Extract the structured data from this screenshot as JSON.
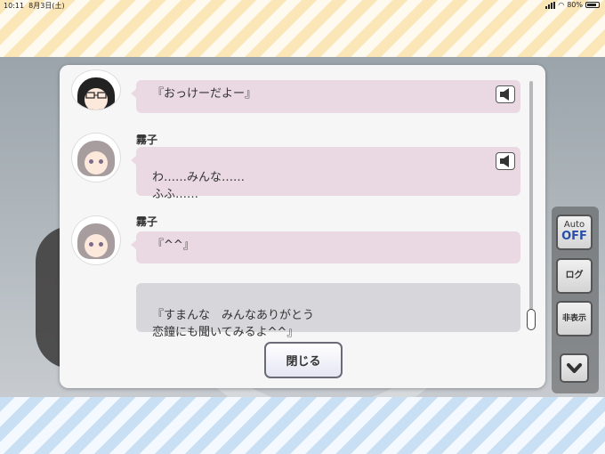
{
  "status_bar": {
    "time": "10:11",
    "date": "8月3日(土)",
    "battery": "80%"
  },
  "log": {
    "entries": [
      {
        "speaker": "",
        "text": "『おっけーだよー』",
        "has_voice": true,
        "avatar": "glasses-character-avatar"
      },
      {
        "speaker": "霧子",
        "text": "わ……みんな……\nふふ……",
        "has_voice": true,
        "avatar": "kiriko-avatar"
      },
      {
        "speaker": "霧子",
        "text": "『^^』",
        "has_voice": false,
        "avatar": "kiriko-avatar"
      },
      {
        "speaker": "",
        "text": "『すまんな　みんなありがとう\n恋鐘にも聞いてみるよ^^』",
        "has_voice": false,
        "avatar": ""
      }
    ],
    "close_label": "閉じる"
  },
  "side_menu": {
    "auto_label": "Auto",
    "auto_state": "OFF",
    "log_label": "ログ",
    "hide_label": "非表示"
  },
  "colors": {
    "bubble": "#ead9e2",
    "bubble_player": "#d6d6db",
    "auto_off": "#2a4fa8"
  }
}
